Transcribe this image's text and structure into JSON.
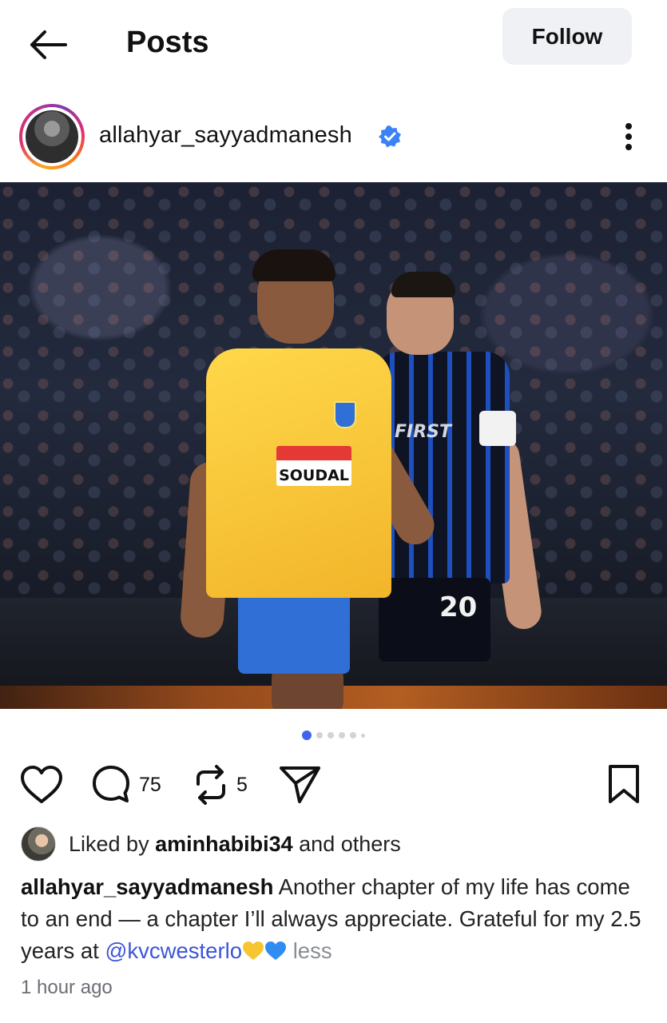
{
  "header": {
    "title": "Posts",
    "follow_label": "Follow"
  },
  "post": {
    "username": "allahyar_sayyadmanesh",
    "verified": true,
    "photo": {
      "sponsor_text": "SOUDAL",
      "opponent_sponsor_text": "FIRST",
      "opponent_number": "20"
    },
    "carousel": {
      "total": 6,
      "active_index": 0
    },
    "actions": {
      "comment_count": "75",
      "repost_count": "5"
    },
    "liked_by": {
      "prefix": "Liked by",
      "user": "aminhabibi34",
      "suffix": "and others"
    },
    "caption": {
      "text_line": "Another chapter of my life has come to an end — a chapter I’ll always appreciate. Grateful for my 2.5 years at",
      "mention": "@kvcwesterlo",
      "emojis": [
        "yellow-heart",
        "blue-heart"
      ],
      "less_label": "less"
    },
    "timestamp": "1 hour ago"
  },
  "colors": {
    "accent": "#3f62f0",
    "mention": "#3b55d9",
    "verified": "#3b82f6",
    "follow_bg": "#eff1f4",
    "jersey_yellow": "#ffd84a",
    "shorts_blue": "#2f6fd6"
  },
  "icons": {
    "back": "arrow-left-icon",
    "verified": "verified-badge-icon",
    "more": "more-vertical-icon",
    "like": "heart-icon",
    "comment": "comment-icon",
    "repost": "repost-icon",
    "share": "send-icon",
    "save": "bookmark-icon"
  }
}
